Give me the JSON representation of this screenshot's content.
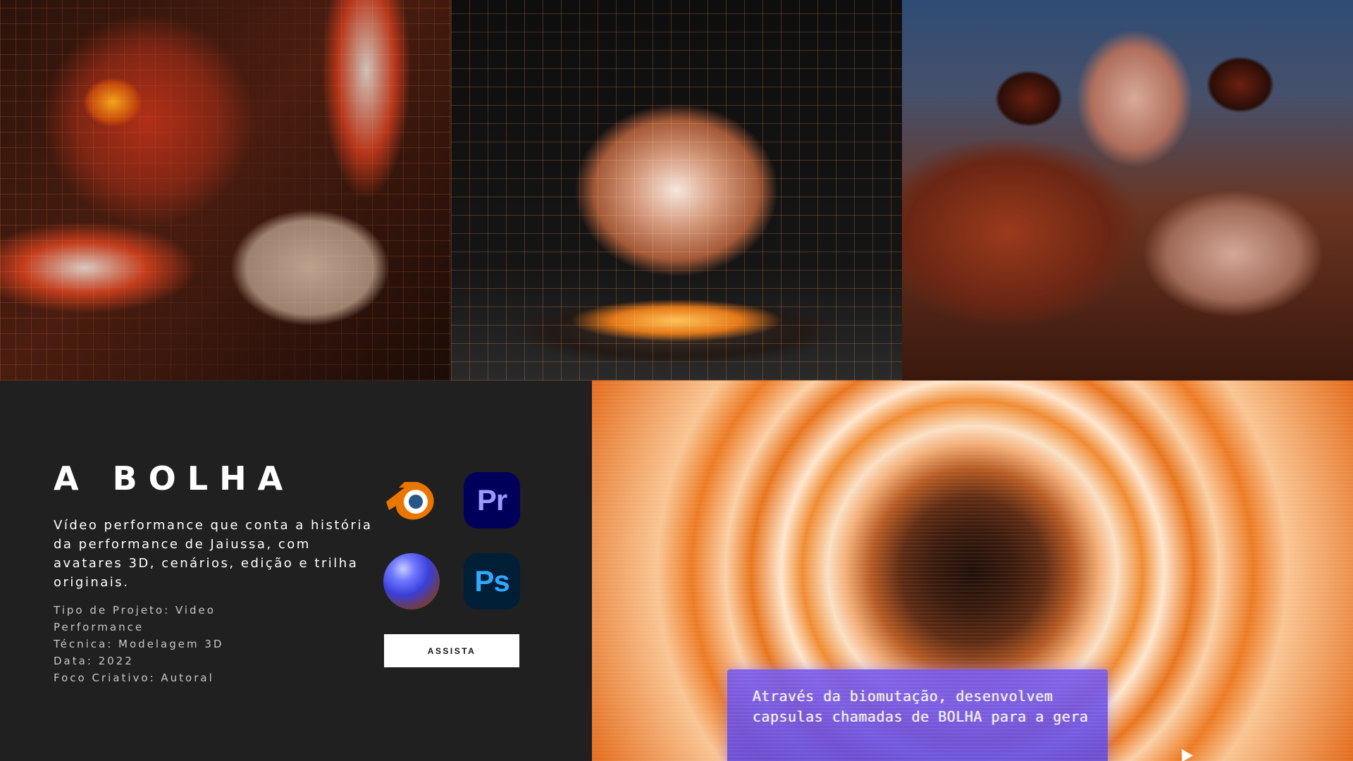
{
  "project": {
    "title": "A BOLHA",
    "description": "Vídeo performance que conta a história da performance de Jaiussa, com avatares 3D, cenários, edição e trilha originais.",
    "meta": [
      "Tipo de Projeto:  Video",
      "Performance",
      "Técnica: Modelagem 3D",
      "Data: 2022",
      "Foco Criativo: Autoral"
    ],
    "watch_label": "ASSISTA"
  },
  "apps": {
    "premiere_glyph": "Pr",
    "photoshop_glyph": "Ps",
    "icons": [
      "blender-icon",
      "premiere-icon",
      "sphere-icon",
      "photoshop-icon"
    ]
  },
  "video": {
    "subtitle": "Através da biomutação, desenvolvem capsulas chamadas de BOLHA para a gera"
  },
  "colors": {
    "panel_background": "#202020",
    "button_background": "#ffffff",
    "blender_orange": "#ea7600",
    "blender_blue": "#265787",
    "premiere_bg": "#00005b",
    "premiere_fg": "#9999ff",
    "photoshop_bg": "#001e36",
    "photoshop_fg": "#31a8ff",
    "subtitle_box": "#6a50e0"
  }
}
